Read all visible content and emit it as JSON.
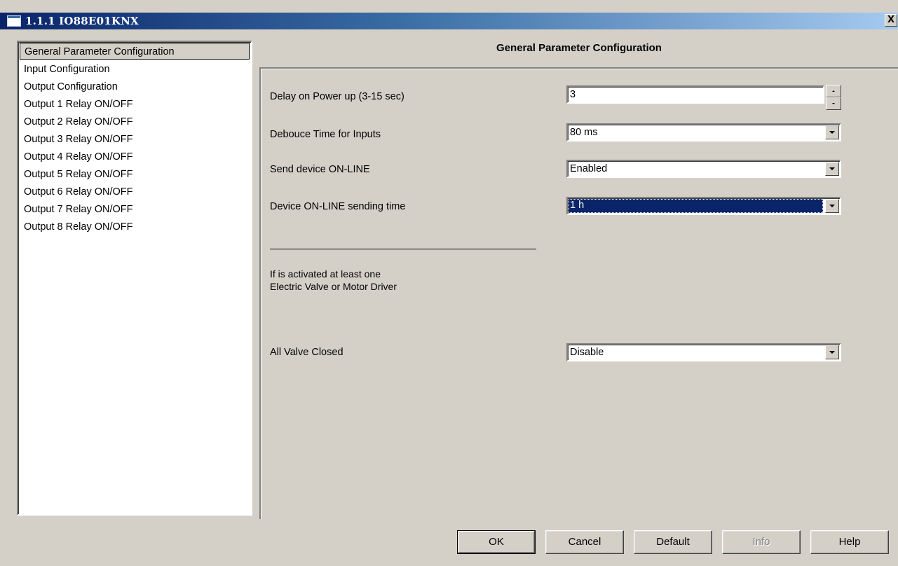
{
  "window": {
    "title": "1.1.1 IO88E01KNX",
    "close_label": "X"
  },
  "sidebar": {
    "items": [
      {
        "label": "General Parameter Configuration",
        "selected": true
      },
      {
        "label": "Input Configuration"
      },
      {
        "label": "Output Configuration"
      },
      {
        "label": "Output 1 Relay ON/OFF"
      },
      {
        "label": "Output 2 Relay ON/OFF"
      },
      {
        "label": "Output 3 Relay ON/OFF"
      },
      {
        "label": "Output 4 Relay ON/OFF"
      },
      {
        "label": "Output 5 Relay ON/OFF"
      },
      {
        "label": "Output 6 Relay ON/OFF"
      },
      {
        "label": "Output 7 Relay ON/OFF"
      },
      {
        "label": "Output 8 Relay ON/OFF"
      }
    ]
  },
  "panel": {
    "title": "General Parameter Configuration",
    "params": {
      "delay": {
        "label": "Delay on Power up (3-15 sec)",
        "value": "3"
      },
      "debounce": {
        "label": "Debouce Time for Inputs",
        "value": "80 ms"
      },
      "online": {
        "label": "Send device ON-LINE",
        "value": "Enabled"
      },
      "online_time": {
        "label": "Device ON-LINE sending time",
        "value": "1 h"
      },
      "valves": {
        "label": "All Valve Closed",
        "value": "Disable"
      }
    },
    "note_line1": "If is activated at least one",
    "note_line2": "Electric Valve or Motor Driver"
  },
  "buttons": {
    "ok": "OK",
    "cancel": "Cancel",
    "default": "Default",
    "info": "Info",
    "help": "Help"
  },
  "colors": {
    "face": "#d4d0c8",
    "title_start": "#0a246a",
    "title_end": "#a6caf0",
    "selection": "#0a246a"
  }
}
